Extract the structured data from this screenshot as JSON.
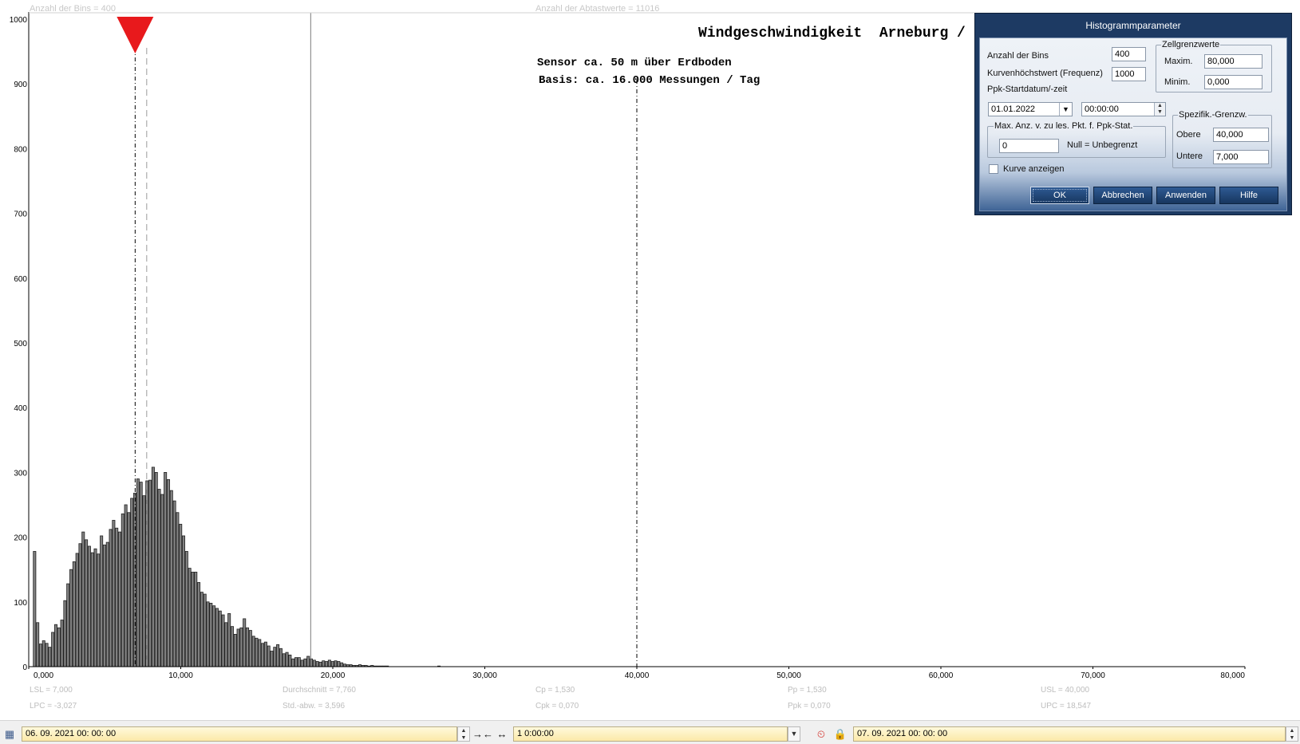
{
  "header": {
    "bins_note": "Anzahl der Bins =   400",
    "samples_note": "Anzahl der Abtastwerte = 11016"
  },
  "chart_data": {
    "type": "bar",
    "title": "Windgeschwindigkeit  Arneburg / Elbe",
    "subtitle_lines": [
      "Sensor ca. 50 m über Erdboden",
      "Basis: ca. 16.000 Messungen / Tag"
    ],
    "xlim": [
      0,
      80
    ],
    "ylim": [
      0,
      1000
    ],
    "x_tick_labels": [
      "0,000",
      "10,000",
      "20,000",
      "30,000",
      "40,000",
      "50,000",
      "60,000",
      "70,000",
      "80,000"
    ],
    "y_tick_labels": [
      "0",
      "100",
      "200",
      "300",
      "400",
      "500",
      "600",
      "700",
      "800",
      "900",
      "1000"
    ],
    "bin_width": 0.2,
    "bin_start": 0.3,
    "values": [
      178,
      68,
      35,
      40,
      36,
      30,
      53,
      65,
      60,
      72,
      102,
      128,
      150,
      162,
      175,
      190,
      208,
      196,
      186,
      176,
      182,
      174,
      202,
      188,
      192,
      212,
      226,
      214,
      208,
      236,
      250,
      238,
      260,
      268,
      290,
      285,
      264,
      287,
      288,
      308,
      300,
      274,
      266,
      300,
      289,
      272,
      256,
      238,
      220,
      202,
      178,
      152,
      146,
      146,
      130,
      115,
      112,
      100,
      98,
      94,
      90,
      86,
      80,
      68,
      82,
      62,
      50,
      58,
      60,
      74,
      60,
      56,
      47,
      44,
      42,
      36,
      38,
      32,
      24,
      30,
      34,
      28,
      20,
      22,
      18,
      12,
      14,
      14,
      10,
      12,
      16,
      12,
      10,
      8,
      7,
      9,
      8,
      10,
      8,
      9,
      8,
      6,
      4,
      3,
      3,
      2,
      2,
      3,
      2,
      2,
      1,
      2,
      1,
      1,
      1,
      1,
      1,
      0,
      0,
      0,
      0,
      0,
      0,
      0,
      0,
      0,
      0,
      0,
      0,
      0,
      0,
      0,
      0,
      1
    ],
    "markers": {
      "lsl": 7.0,
      "mean": 7.76,
      "upc": 18.547,
      "usl": 40.0
    },
    "stats": {
      "lsl": "LSL = 7,000",
      "lpc": "LPC = -3,027",
      "mean": "Durchschnitt  = 7,760",
      "std": "Std.-abw.  = 3,596",
      "cp": "Cp  = 1,530",
      "cpk": "Cpk = 0,070",
      "pp": "Pp  = 1,530",
      "ppk": "Ppk = 0,070",
      "usl": "USL = 40,000",
      "upc": "UPC = 18,547"
    },
    "colors": {
      "bar_fill": "#808080",
      "bar_stroke": "#202020",
      "marker": "#e8191c",
      "axis": "#000000"
    }
  },
  "dialog": {
    "title": "Histogrammparameter",
    "bins_label": "Anzahl der Bins",
    "bins_value": "400",
    "curve_max_label": "Kurvenhöchstwert (Frequenz)",
    "curve_max_value": "1000",
    "ppk_start_label": "Ppk-Startdatum/-zeit",
    "date_value": "01.01.2022",
    "time_value": "00:00:00",
    "max_points_label": "Max. Anz. v. zu les. Pkt. f. Ppk-Stat.",
    "max_points_value": "0",
    "null_hint": "Null = Unbegrenzt",
    "cell_limits_title": "Zellgrenzwerte",
    "max_label": "Maxim.",
    "max_value": "80,000",
    "min_label": "Minim.",
    "min_value": "0,000",
    "spec_title": "Spezifik.-Grenzw.",
    "upper_label": "Obere",
    "upper_value": "40,000",
    "lower_label": "Untere",
    "lower_value": "7,000",
    "show_curve_label": "Kurve anzeigen",
    "ok_label": "OK",
    "cancel_label": "Abbrechen",
    "apply_label": "Anwenden",
    "help_label": "Hilfe"
  },
  "bottom": {
    "start_value": "06. 09. 2021    00: 00: 00",
    "interval_value": "1 0:00:00",
    "end_value": "07. 09. 2021    00: 00: 00"
  }
}
